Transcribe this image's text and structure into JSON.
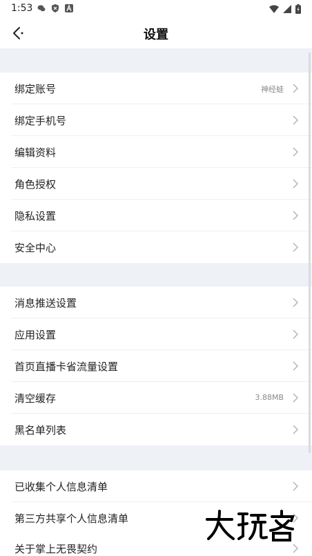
{
  "status_bar": {
    "time": "1:53",
    "left_icons": [
      "wechat-icon",
      "shield-icon",
      "a-app-icon"
    ],
    "right_icons": [
      "wifi-icon",
      "signal-icon",
      "battery-icon"
    ]
  },
  "header": {
    "title": "设置",
    "back_icon": "back-arrow-icon"
  },
  "sections": [
    {
      "rows": [
        {
          "label": "绑定账号",
          "value": "神经蛙"
        },
        {
          "label": "绑定手机号",
          "value": ""
        },
        {
          "label": "编辑资料",
          "value": ""
        },
        {
          "label": "角色授权",
          "value": ""
        },
        {
          "label": "隐私设置",
          "value": ""
        },
        {
          "label": "安全中心",
          "value": ""
        }
      ]
    },
    {
      "rows": [
        {
          "label": "消息推送设置",
          "value": ""
        },
        {
          "label": "应用设置",
          "value": ""
        },
        {
          "label": "首页直播卡省流量设置",
          "value": ""
        },
        {
          "label": "清空缓存",
          "value": "3.88MB"
        },
        {
          "label": "黑名单列表",
          "value": ""
        }
      ]
    },
    {
      "rows": [
        {
          "label": "已收集个人信息清单",
          "value": ""
        },
        {
          "label": "第三方共享个人信息清单",
          "value": ""
        },
        {
          "label": "关于掌上无畏契约",
          "value": ""
        }
      ]
    }
  ],
  "colors": {
    "background_gray": "#eef1f6",
    "text": "#222222",
    "secondary_text": "#8a8a8a",
    "chevron": "#b5b5b5"
  }
}
